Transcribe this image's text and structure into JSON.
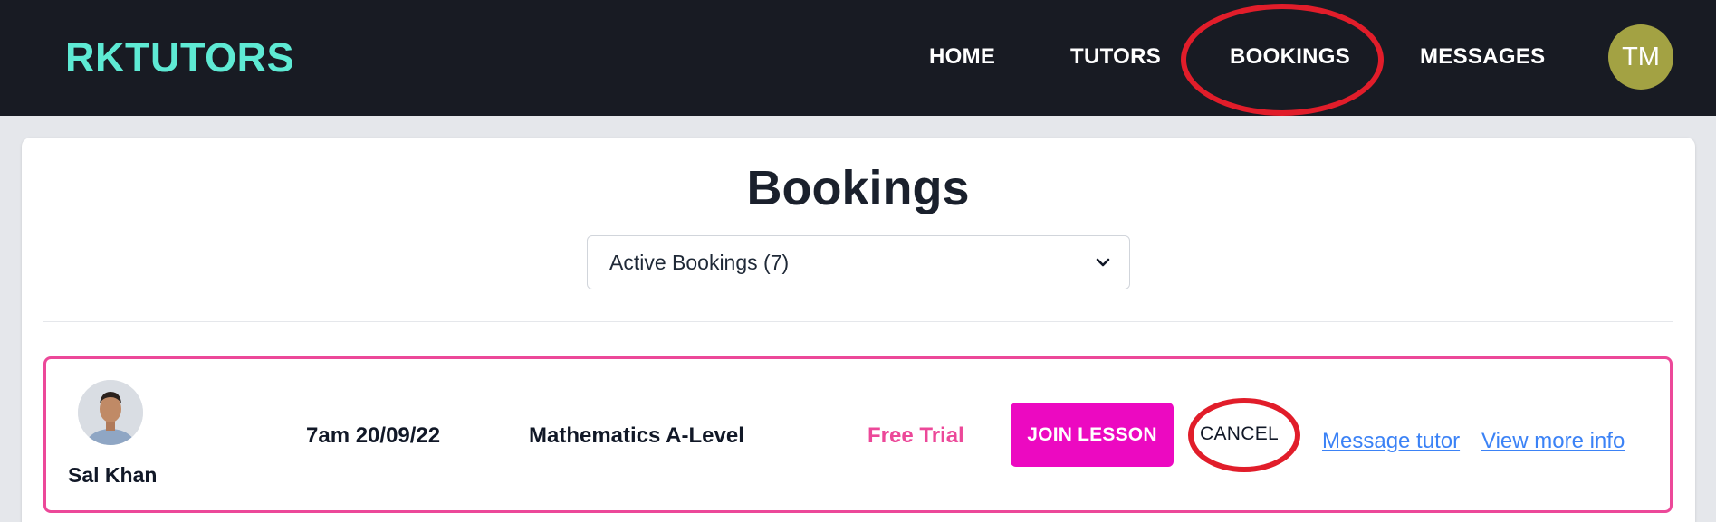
{
  "nav": {
    "brand": "RKTUTORS",
    "links": [
      "HOME",
      "TUTORS",
      "BOOKINGS",
      "MESSAGES"
    ],
    "avatar_initials": "TM"
  },
  "page": {
    "title": "Bookings",
    "filter_select": "Active Bookings (7)"
  },
  "bookings": [
    {
      "tutor_name": "Sal Khan",
      "datetime": "7am 20/09/22",
      "subject": "Mathematics A-Level",
      "type": "Free Trial",
      "join_label": "JOIN LESSON",
      "cancel_label": "CANCEL",
      "message_link": "Message tutor",
      "info_link": "View more info"
    }
  ],
  "colors": {
    "navbar": "#181b23",
    "brand": "#5eead4",
    "accent_pink": "#ec4899",
    "join_button": "#ec09c1",
    "link_blue": "#3b82f6",
    "annotation_red": "#e11d2a",
    "avatar": "#a3a243"
  }
}
